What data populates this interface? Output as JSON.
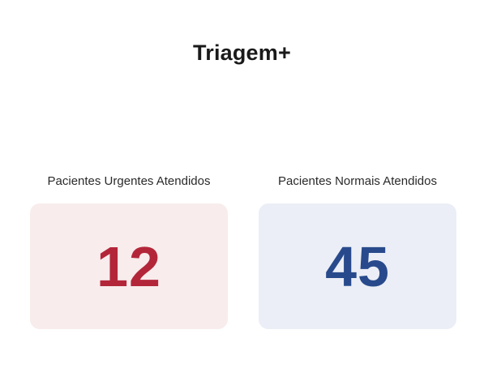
{
  "app": {
    "title": "Triagem+"
  },
  "stats": [
    {
      "label": "Pacientes Urgentes Atendidos",
      "value": "12",
      "card_bg": "#f8ecec",
      "value_color": "#b3263a"
    },
    {
      "label": "Pacientes Normais Atendidos",
      "value": "45",
      "card_bg": "#ebeef6",
      "value_color": "#284a8c"
    }
  ]
}
